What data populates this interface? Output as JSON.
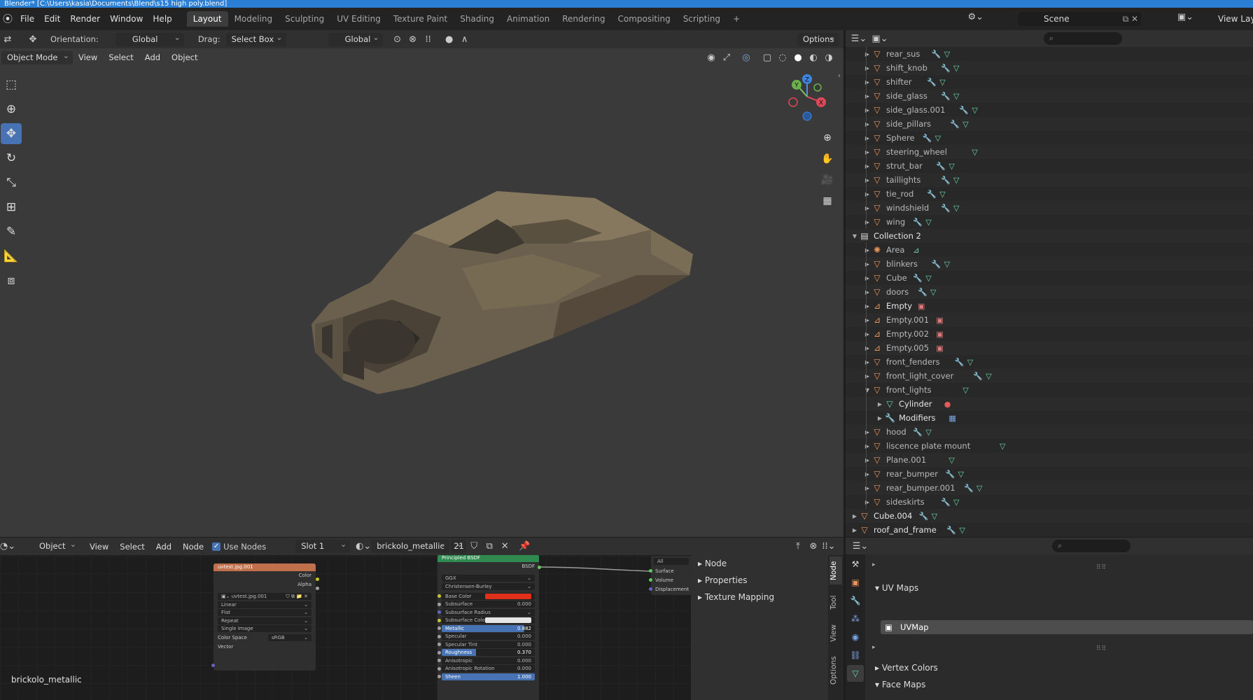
{
  "window": {
    "title": "Blender* [C:\\Users\\kasia\\Documents\\Blend\\s15 high poly.blend]"
  },
  "menu": {
    "items": [
      "File",
      "Edit",
      "Render",
      "Window",
      "Help"
    ]
  },
  "workspaces": {
    "tabs": [
      "Layout",
      "Modeling",
      "Sculpting",
      "UV Editing",
      "Texture Paint",
      "Shading",
      "Animation",
      "Rendering",
      "Compositing",
      "Scripting"
    ],
    "active": "Layout",
    "add": "+"
  },
  "scene": {
    "name": "Scene",
    "view_layer": "View Layer"
  },
  "viewport": {
    "orientation_label": "Orientation:",
    "orientation_value": "Global",
    "drag_label": "Drag:",
    "drag_value": "Select Box",
    "transform_orientation": "Global",
    "options_label": "Options",
    "mode": "Object Mode",
    "menus": [
      "View",
      "Select",
      "Add",
      "Object"
    ],
    "gizmo": {
      "x": "X",
      "y": "Y",
      "z": "Z"
    }
  },
  "outliner": {
    "search_placeholder": "",
    "rows": [
      {
        "name": "rear_sus",
        "depth": 1,
        "type": "mesh",
        "mod": true
      },
      {
        "name": "shift_knob",
        "depth": 1,
        "type": "mesh",
        "mod": true
      },
      {
        "name": "shifter",
        "depth": 1,
        "type": "mesh",
        "mod": true
      },
      {
        "name": "side_glass",
        "depth": 1,
        "type": "mesh",
        "mod": true
      },
      {
        "name": "side_glass.001",
        "depth": 1,
        "type": "mesh",
        "mod": true
      },
      {
        "name": "side_pillars",
        "depth": 1,
        "type": "mesh",
        "mod": true
      },
      {
        "name": "Sphere",
        "depth": 1,
        "type": "mesh",
        "mod": true
      },
      {
        "name": "steering_wheel",
        "depth": 1,
        "type": "mesh",
        "mod": false
      },
      {
        "name": "strut_bar",
        "depth": 1,
        "type": "mesh",
        "mod": true
      },
      {
        "name": "taillights",
        "depth": 1,
        "type": "mesh",
        "mod": true
      },
      {
        "name": "tie_rod",
        "depth": 1,
        "type": "mesh",
        "mod": true
      },
      {
        "name": "windshield",
        "depth": 1,
        "type": "mesh",
        "mod": true
      },
      {
        "name": "wing",
        "depth": 1,
        "type": "mesh",
        "mod": true
      },
      {
        "name": "Collection 2",
        "depth": 0,
        "type": "collection",
        "expanded": true
      },
      {
        "name": "Area",
        "depth": 1,
        "type": "light"
      },
      {
        "name": "blinkers",
        "depth": 1,
        "type": "mesh",
        "mod": true
      },
      {
        "name": "Cube",
        "depth": 1,
        "type": "mesh",
        "mod": true
      },
      {
        "name": "doors",
        "depth": 1,
        "type": "mesh",
        "mod": true
      },
      {
        "name": "Empty",
        "depth": 1,
        "type": "empty",
        "bright": true
      },
      {
        "name": "Empty.001",
        "depth": 1,
        "type": "empty"
      },
      {
        "name": "Empty.002",
        "depth": 1,
        "type": "empty"
      },
      {
        "name": "Empty.005",
        "depth": 1,
        "type": "empty"
      },
      {
        "name": "front_fenders",
        "depth": 1,
        "type": "mesh",
        "mod": true
      },
      {
        "name": "front_light_cover",
        "depth": 1,
        "type": "mesh",
        "mod": true
      },
      {
        "name": "front_lights",
        "depth": 1,
        "type": "mesh",
        "expanded": true,
        "mod": false
      },
      {
        "name": "Cylinder",
        "depth": 2,
        "type": "meshdata",
        "bright": true
      },
      {
        "name": "Modifiers",
        "depth": 2,
        "type": "modifiers",
        "bright": true
      },
      {
        "name": "hood",
        "depth": 1,
        "type": "mesh",
        "mod": true
      },
      {
        "name": "liscence plate mount",
        "depth": 1,
        "type": "mesh",
        "mod": false
      },
      {
        "name": "Plane.001",
        "depth": 1,
        "type": "mesh",
        "mod": false
      },
      {
        "name": "rear_bumper",
        "depth": 1,
        "type": "mesh",
        "mod": true
      },
      {
        "name": "rear_bumper.001",
        "depth": 1,
        "type": "mesh",
        "mod": true
      },
      {
        "name": "sideskirts",
        "depth": 1,
        "type": "mesh",
        "mod": true
      },
      {
        "name": "Cube.004",
        "depth": 0,
        "type": "mesh",
        "mod": true,
        "bright": true
      },
      {
        "name": "roof_and_frame",
        "depth": 0,
        "type": "mesh",
        "mod": true,
        "bright": true
      }
    ]
  },
  "node_editor": {
    "object_type": "Object",
    "menus": [
      "View",
      "Select",
      "Add",
      "Node"
    ],
    "use_nodes_label": "Use Nodes",
    "slot": "Slot 1",
    "material": "brickolo_metallic",
    "users": "21",
    "material_label": "brickolo_metallic",
    "image_node": {
      "title": "uvtest.jpg.001",
      "outputs": [
        "Color",
        "Alpha"
      ],
      "image": "uvtest.jpg.001",
      "interpolation": "Linear",
      "projection": "Flat",
      "extension": "Repeat",
      "source": "Single Image",
      "color_space_label": "Color Space",
      "color_space": "sRGB",
      "input": "Vector"
    },
    "bsdf_node": {
      "title": "Principled BSDF",
      "output": "BSDF",
      "distribution": "GGX",
      "subsurface_method": "Christensen-Burley",
      "inputs": [
        {
          "label": "Base Color",
          "value": "",
          "kind": "color",
          "color": "#e0301a"
        },
        {
          "label": "Subsurface",
          "value": "0.000"
        },
        {
          "label": "Subsurface Radius",
          "value": "",
          "kind": "dropdown"
        },
        {
          "label": "Subsurface Colo",
          "value": "",
          "kind": "color",
          "color": "#e6e6e6"
        },
        {
          "label": "Metallic",
          "value": "0.882",
          "kind": "bar"
        },
        {
          "label": "Specular",
          "value": "0.000"
        },
        {
          "label": "Specular Tint",
          "value": "0.000"
        },
        {
          "label": "Roughness",
          "value": "0.370",
          "kind": "bar"
        },
        {
          "label": "Anisotropic",
          "value": "0.000"
        },
        {
          "label": "Anisotropic Rotation",
          "value": "0.000"
        },
        {
          "label": "Sheen",
          "value": "1.000",
          "kind": "bar"
        }
      ]
    },
    "output_node": {
      "target": "All",
      "inputs": [
        "Surface",
        "Volume",
        "Displacement"
      ]
    },
    "sidebar": {
      "items": [
        "Node",
        "Properties",
        "Texture Mapping"
      ]
    },
    "tabs": [
      "Node",
      "Tool",
      "View",
      "Options"
    ]
  },
  "properties": {
    "sections": [
      "UV Maps",
      "Vertex Colors",
      "Face Maps"
    ],
    "uv_map": "UVMap"
  }
}
